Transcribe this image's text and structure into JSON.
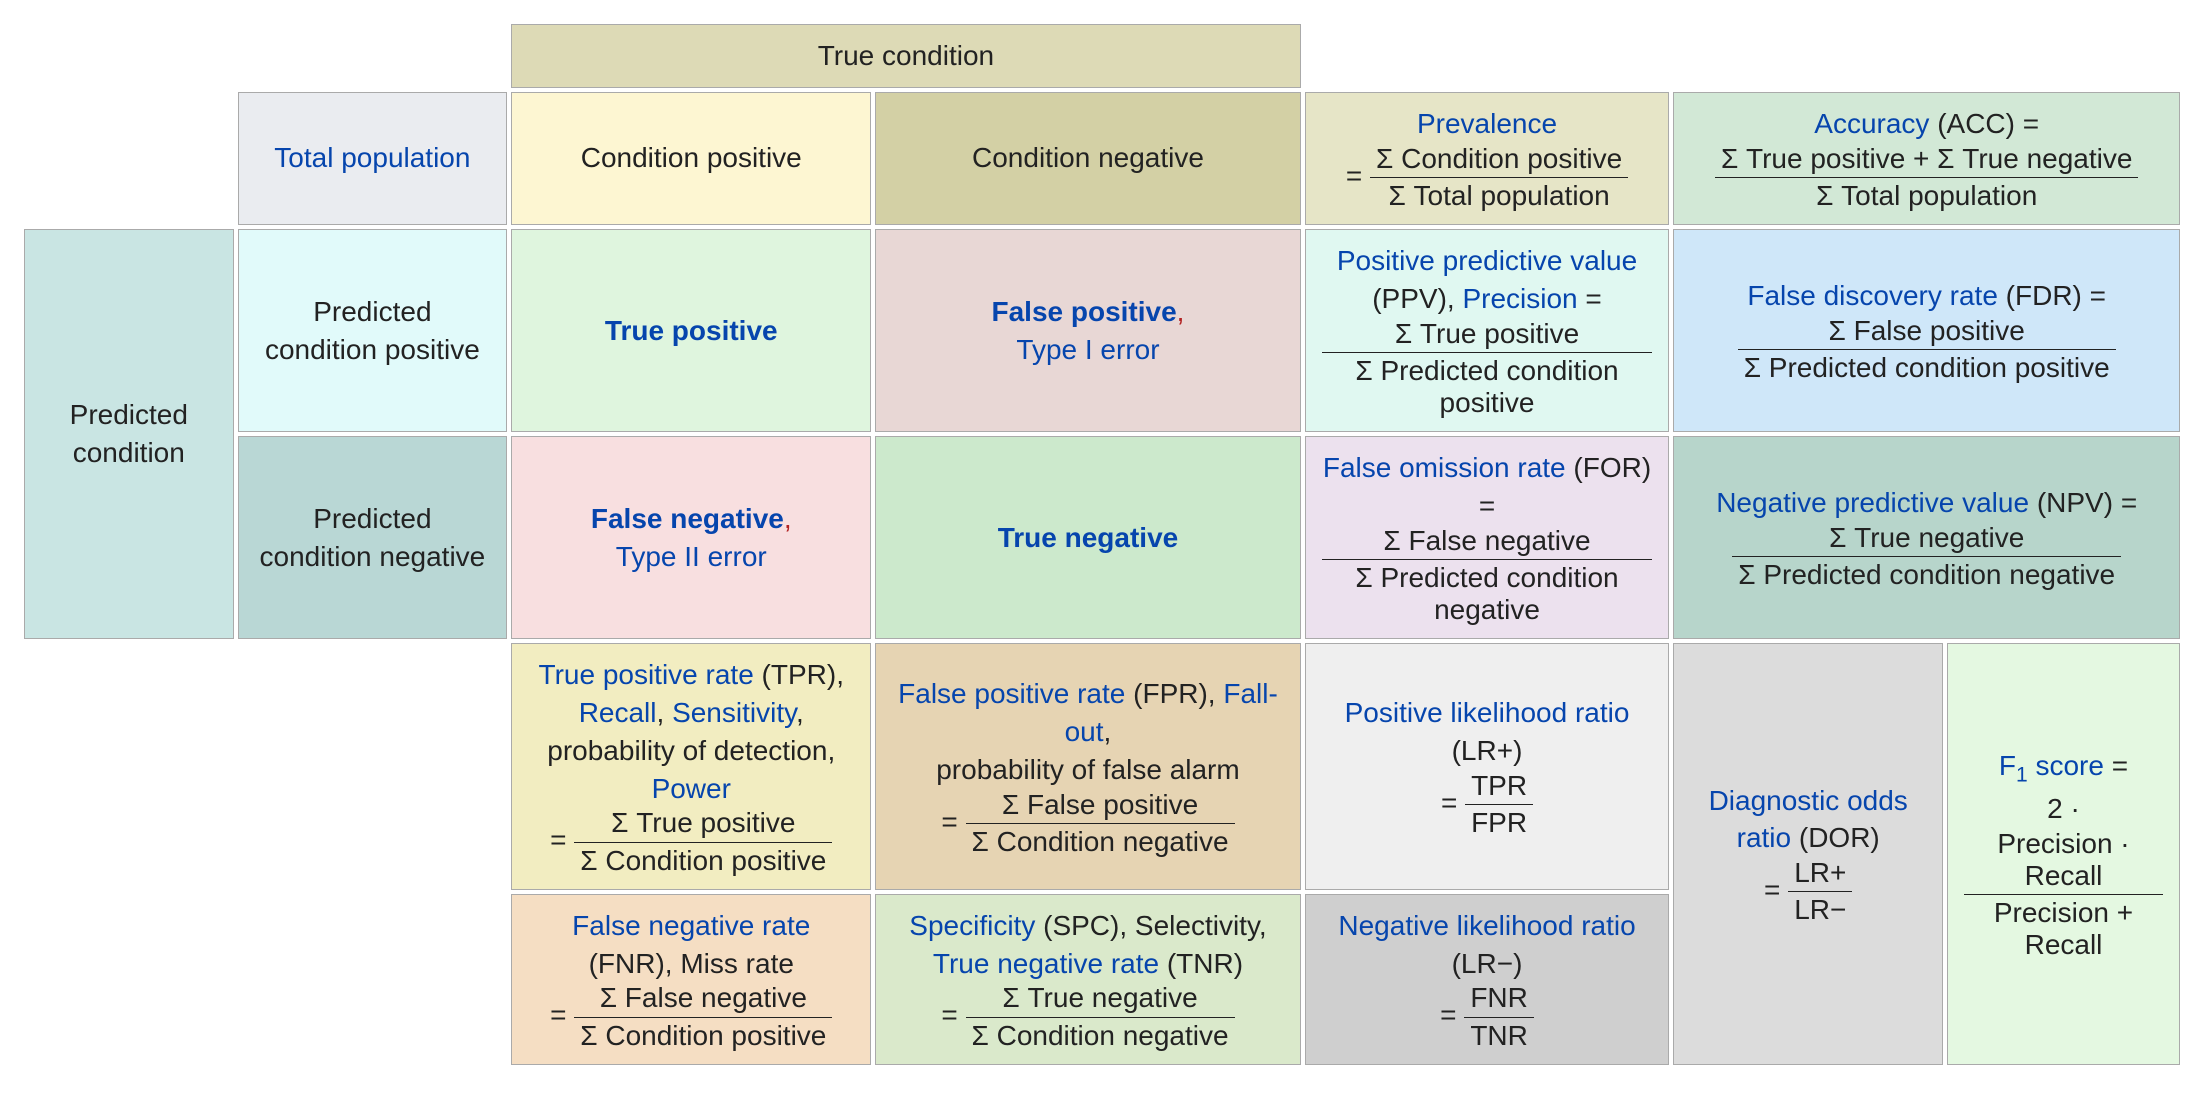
{
  "headers": {
    "true_condition": "True condition",
    "total_population": "Total population",
    "condition_positive": "Condition positive",
    "condition_negative": "Condition negative",
    "predicted_condition": "Predicted condition",
    "predicted_positive": "Predicted condition positive",
    "predicted_negative": "Predicted condition negative"
  },
  "core": {
    "tp": "True positive",
    "fp": "False positive",
    "type1": "Type I error",
    "fn": "False negative",
    "type2": "Type II error",
    "tn": "True negative"
  },
  "prevalence": {
    "name": "Prevalence",
    "num": "Σ Condition positive",
    "den": "Σ Total population"
  },
  "accuracy": {
    "name": "Accuracy",
    "abbr": " (ACC) =",
    "num": "Σ True positive + Σ True negative",
    "den": "Σ Total population"
  },
  "ppv": {
    "name": "Positive predictive value",
    "abbr": " (PPV), ",
    "precision": "Precision",
    "num": "Σ True positive",
    "den": "Σ Predicted condition positive"
  },
  "fdr": {
    "name": "False discovery rate",
    "abbr": " (FDR) =",
    "num": "Σ False positive",
    "den": "Σ Predicted condition positive"
  },
  "for": {
    "name": "False omission rate",
    "abbr": " (FOR) =",
    "num": "Σ False negative",
    "den": "Σ Predicted condition negative"
  },
  "npv": {
    "name": "Negative predictive value",
    "abbr": " (NPV) =",
    "num": "Σ True negative",
    "den": "Σ Predicted condition negative"
  },
  "tpr": {
    "name": "True positive rate",
    "abbr": " (TPR), ",
    "recall": "Recall",
    "sensitivity": "Sensitivity",
    "prob": "probability of detection, ",
    "power": "Power",
    "num": "Σ True positive",
    "den": "Σ Condition positive"
  },
  "fpr": {
    "name": "False positive rate",
    "abbr": " (FPR), ",
    "fallout": "Fall-out",
    "prob": "probability of false alarm",
    "num": "Σ False positive",
    "den": "Σ Condition negative"
  },
  "lrp": {
    "name": "Positive likelihood ratio",
    "abbr": " (LR+)",
    "num": "TPR",
    "den": "FPR"
  },
  "dor": {
    "name": "Diagnostic odds ratio",
    "abbr": " (DOR)",
    "num": "LR+",
    "den": "LR−"
  },
  "f1": {
    "name_pre": "F",
    "name_post": " score",
    "pre": "2 · ",
    "num": "Precision · Recall",
    "den": "Precision + Recall"
  },
  "fnr": {
    "name": "False negative rate",
    "abbr": " (FNR), ",
    "miss": "Miss rate",
    "num": "Σ False negative",
    "den": "Σ Condition positive"
  },
  "spc": {
    "name": "Specificity",
    "abbr": " (SPC), ",
    "selectivity": "Selectivity, ",
    "tnr": "True negative rate",
    "tnr_abbr": " (TNR)",
    "num": "Σ True negative",
    "den": "Σ Condition negative"
  },
  "lrn": {
    "name": "Negative likelihood ratio",
    "abbr": " (LR−)",
    "num": "FNR",
    "den": "TNR"
  },
  "misc": {
    "eq": " = ",
    "eq_only": "= ",
    "comma": ",",
    "sep": ", "
  }
}
